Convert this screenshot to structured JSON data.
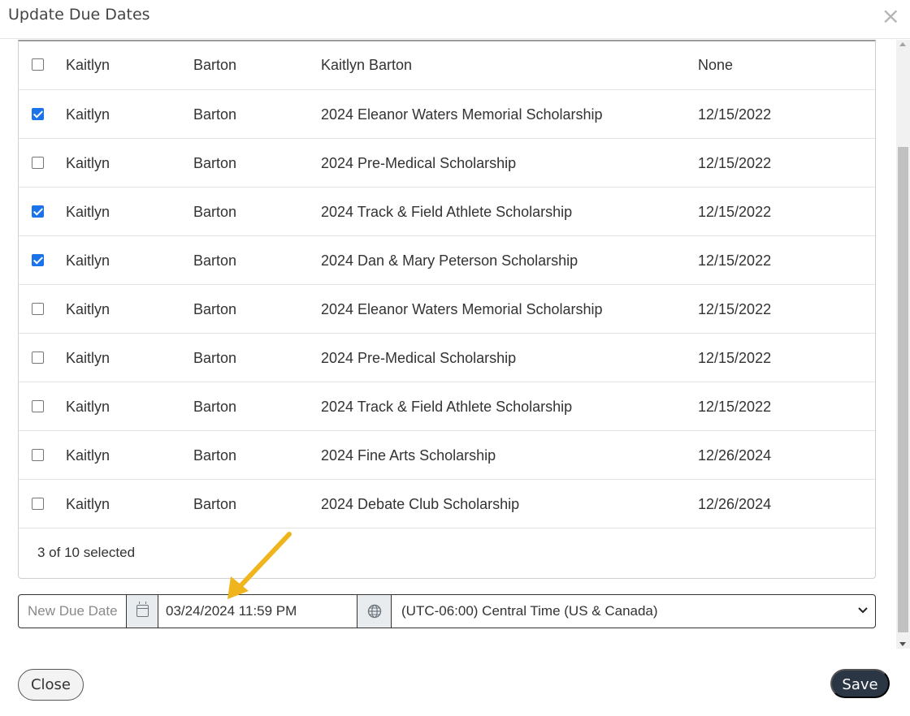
{
  "modal": {
    "title": "Update Due Dates",
    "close_glyph": "×"
  },
  "rows": [
    {
      "checked": false,
      "first": "Kaitlyn",
      "last": "Barton",
      "name": "Kaitlyn Barton",
      "due": "None"
    },
    {
      "checked": true,
      "first": "Kaitlyn",
      "last": "Barton",
      "name": "2024 Eleanor Waters Memorial Scholarship",
      "due": "12/15/2022"
    },
    {
      "checked": false,
      "first": "Kaitlyn",
      "last": "Barton",
      "name": "2024 Pre-Medical Scholarship",
      "due": "12/15/2022"
    },
    {
      "checked": true,
      "first": "Kaitlyn",
      "last": "Barton",
      "name": "2024 Track & Field Athlete Scholarship",
      "due": "12/15/2022"
    },
    {
      "checked": true,
      "first": "Kaitlyn",
      "last": "Barton",
      "name": "2024 Dan & Mary Peterson Scholarship",
      "due": "12/15/2022"
    },
    {
      "checked": false,
      "first": "Kaitlyn",
      "last": "Barton",
      "name": "2024 Eleanor Waters Memorial Scholarship",
      "due": "12/15/2022"
    },
    {
      "checked": false,
      "first": "Kaitlyn",
      "last": "Barton",
      "name": "2024 Pre-Medical Scholarship",
      "due": "12/15/2022"
    },
    {
      "checked": false,
      "first": "Kaitlyn",
      "last": "Barton",
      "name": "2024 Track & Field Athlete Scholarship",
      "due": "12/15/2022"
    },
    {
      "checked": false,
      "first": "Kaitlyn",
      "last": "Barton",
      "name": "2024 Fine Arts Scholarship",
      "due": "12/26/2024"
    },
    {
      "checked": false,
      "first": "Kaitlyn",
      "last": "Barton",
      "name": "2024 Debate Club Scholarship",
      "due": "12/26/2024"
    }
  ],
  "selection_summary": "3 of 10 selected",
  "due_date": {
    "label": "New Due Date",
    "value": "03/24/2024 11:59 PM",
    "timezone": "(UTC-06:00) Central Time (US & Canada)"
  },
  "buttons": {
    "close": "Close",
    "save": "Save"
  },
  "colors": {
    "checkbox_checked": "#1a73e8",
    "save_button_bg": "#2b3645",
    "annotation_arrow": "#f0b41c"
  },
  "icons": {
    "calendar": "calendar-icon",
    "globe": "globe-icon",
    "dropdown": "chevron-down-icon",
    "annotation": "arrow-annotation"
  }
}
